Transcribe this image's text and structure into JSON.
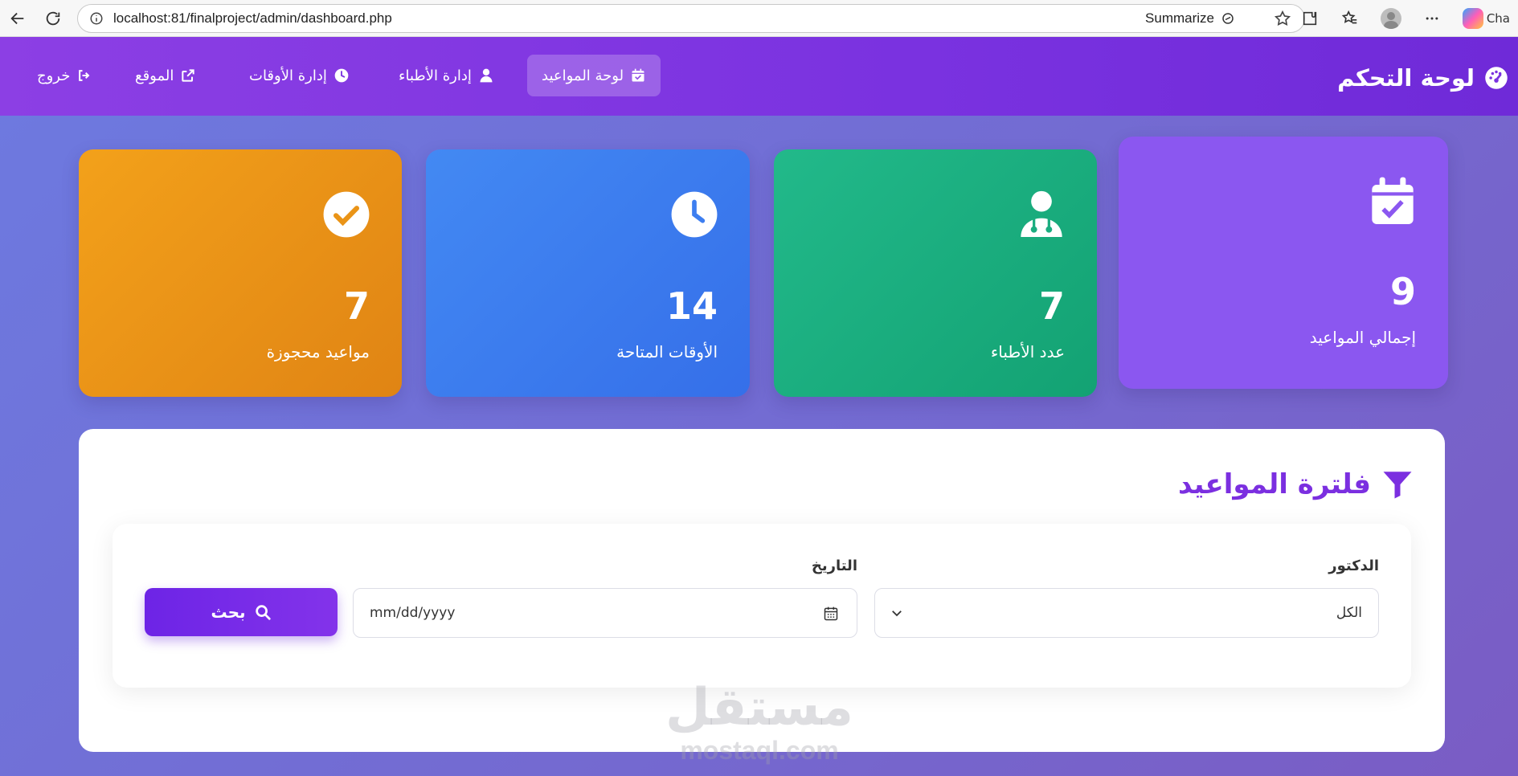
{
  "browser": {
    "url": "localhost:81/finalproject/admin/dashboard.php",
    "summarize_label": "Summarize",
    "copilot_label": "Cha"
  },
  "nav": {
    "brand": "لوحة التحكم",
    "items": [
      {
        "label": "لوحة المواعيد",
        "icon": "calendar-check-icon",
        "active": true
      },
      {
        "label": "إدارة الأطباء",
        "icon": "user-doctor-icon"
      },
      {
        "label": "إدارة الأوقات",
        "icon": "clock-icon"
      },
      {
        "label": "الموقع",
        "icon": "external-link-icon"
      },
      {
        "label": "خروج",
        "icon": "sign-out-icon"
      }
    ]
  },
  "stats": [
    {
      "label": "إجمالي المواعيد",
      "value": "9",
      "icon": "calendar-check-icon",
      "color": "#8b57f0"
    },
    {
      "label": "عدد الأطباء",
      "value": "7",
      "icon": "user-doctor-icon",
      "color": "#1bad80"
    },
    {
      "label": "الأوقات المتاحة",
      "value": "14",
      "icon": "clock-icon",
      "color": "#3d7ef0"
    },
    {
      "label": "مواعيد محجوزة",
      "value": "7",
      "icon": "check-circle-icon",
      "color": "#ea9417"
    }
  ],
  "filter": {
    "title": "فلترة المواعيد",
    "doctor_label": "الدكتور",
    "doctor_value": "الكل",
    "date_label": "التاريخ",
    "date_placeholder": "mm/dd/yyyy",
    "search_label": "بحث"
  },
  "watermark": {
    "arabic": "مستقل",
    "latin": "mostaql.com"
  },
  "colors": {
    "accent": "#7b2fe0",
    "nav_bg": "#7a32e0"
  }
}
